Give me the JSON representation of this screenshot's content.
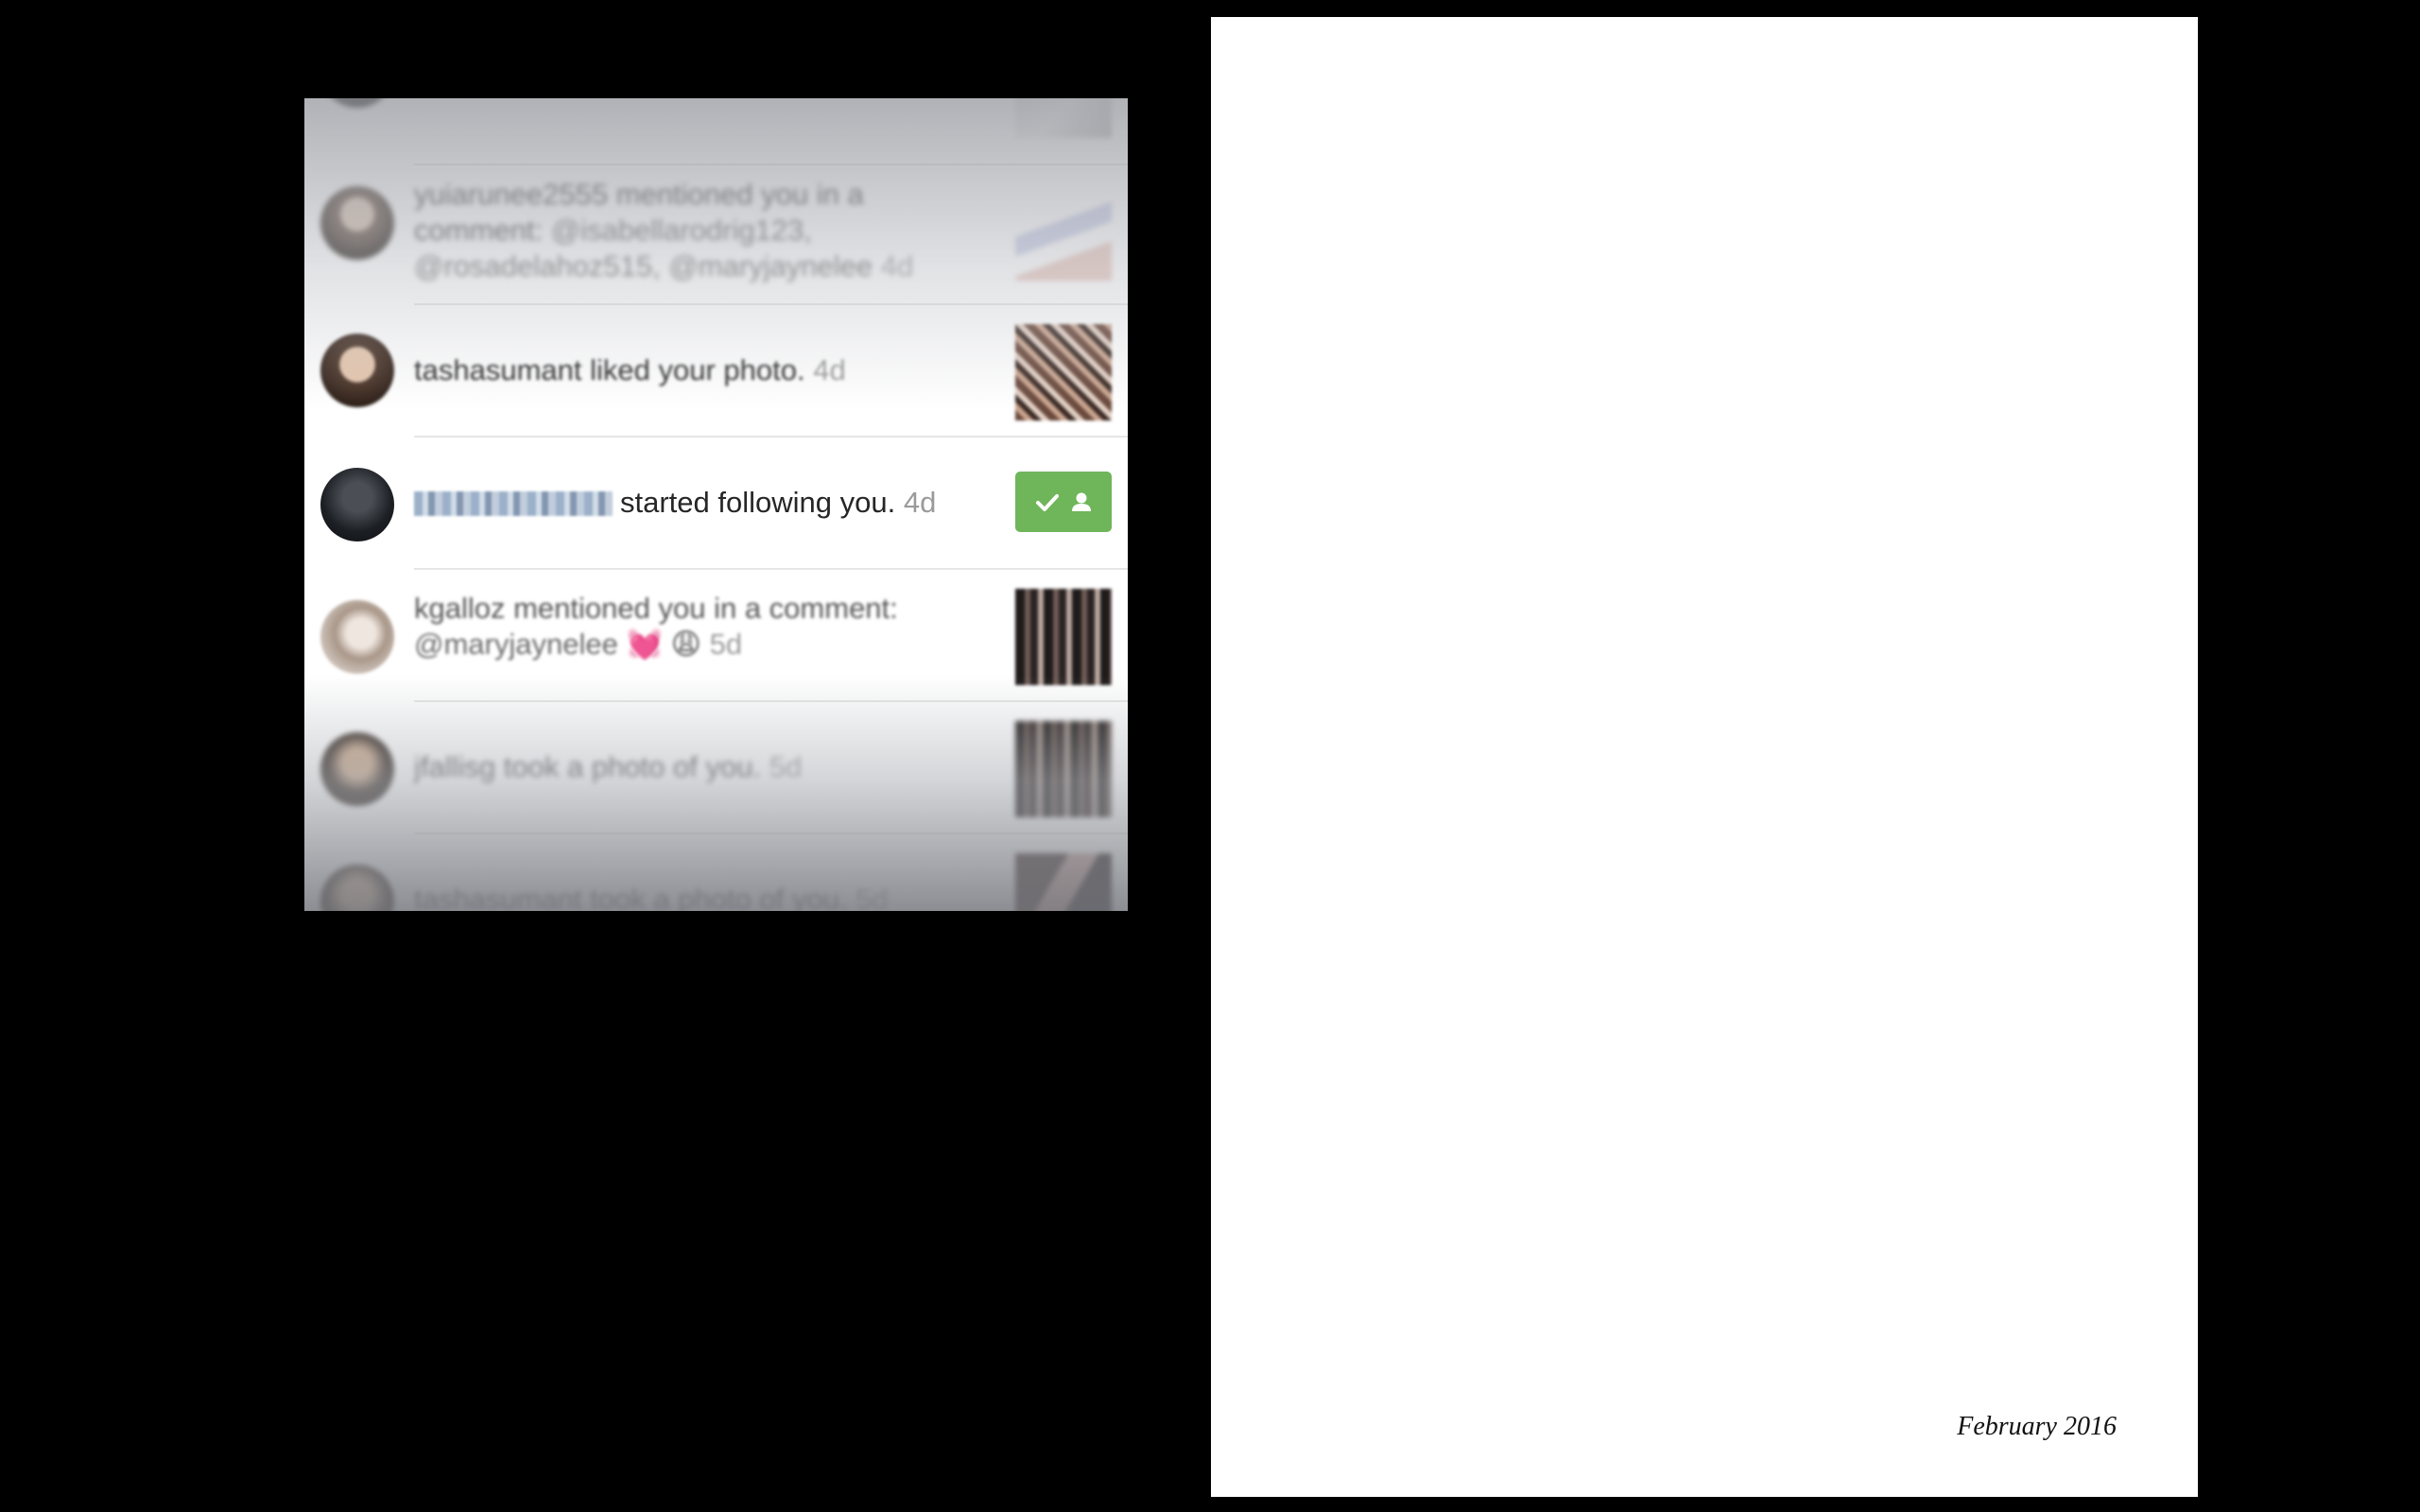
{
  "notifications": [
    {
      "text": "",
      "time": ""
    },
    {
      "user": "yuiarunee2555",
      "action": " mentioned you in a comment: ",
      "mentions": "@isabellarodrig123, @rosadelahoz515, @maryjaynelee",
      "time": " 4d"
    },
    {
      "user": "tashasumant",
      "action": " liked your photo.",
      "time": " 4d"
    },
    {
      "action": "started following you.",
      "time": " 4d",
      "button_state": "following"
    },
    {
      "user": "kgalloz",
      "action": " mentioned you in a comment:",
      "mentions": "@maryjaynelee",
      "emoji": "💓 😩",
      "time": " 5d"
    },
    {
      "user": "jfallisg",
      "action": " took a photo of you.",
      "time": " 5d"
    },
    {
      "user": "tashasumant",
      "action": " took a photo of you.",
      "time": " 5d"
    }
  ],
  "page": {
    "date": "February 2016"
  },
  "colors": {
    "follow_button": "#6fb55a",
    "background": "#000000",
    "page": "#ffffff"
  },
  "icons": {
    "follow_check": "checkmark-icon",
    "follow_person": "person-icon"
  }
}
